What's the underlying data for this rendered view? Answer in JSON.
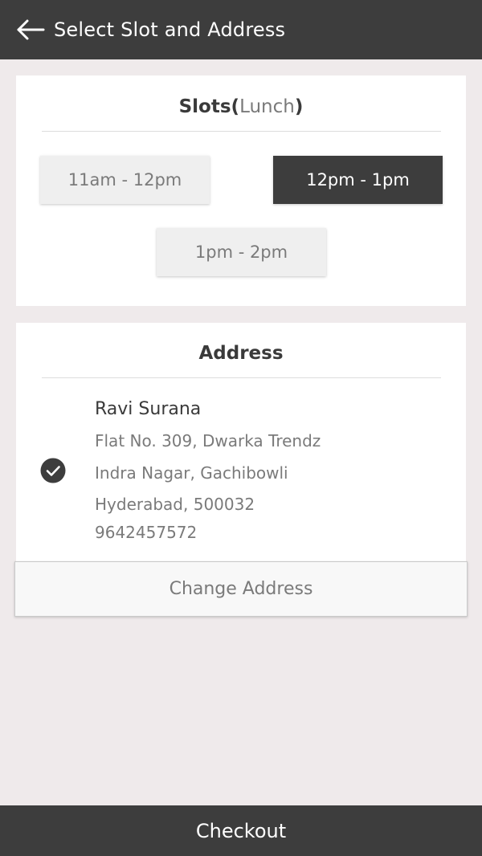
{
  "header": {
    "title": "Select Slot and Address",
    "back_icon": "arrow-left-icon"
  },
  "slots": {
    "title": "Slots",
    "meal": "Lunch",
    "open_paren": "(",
    "close_paren": ")",
    "options": [
      {
        "label": "11am - 12pm",
        "selected": false
      },
      {
        "label": "12pm - 1pm",
        "selected": true
      },
      {
        "label": "1pm - 2pm",
        "selected": false
      }
    ]
  },
  "address": {
    "title": "Address",
    "name": "Ravi Surana",
    "line1": "Flat No. 309, Dwarka Trendz",
    "line2": "Indra Nagar, Gachibowli",
    "line3": "Hyderabad, 500032",
    "phone": "9642457572",
    "selected_icon": "check-circle-icon"
  },
  "change_address_label": "Change Address",
  "checkout_label": "Checkout",
  "colors": {
    "bar": "#3d3d3d",
    "background": "#efeaeb",
    "selected_slot": "#3d3d3d",
    "unselected_slot": "#efefef"
  }
}
